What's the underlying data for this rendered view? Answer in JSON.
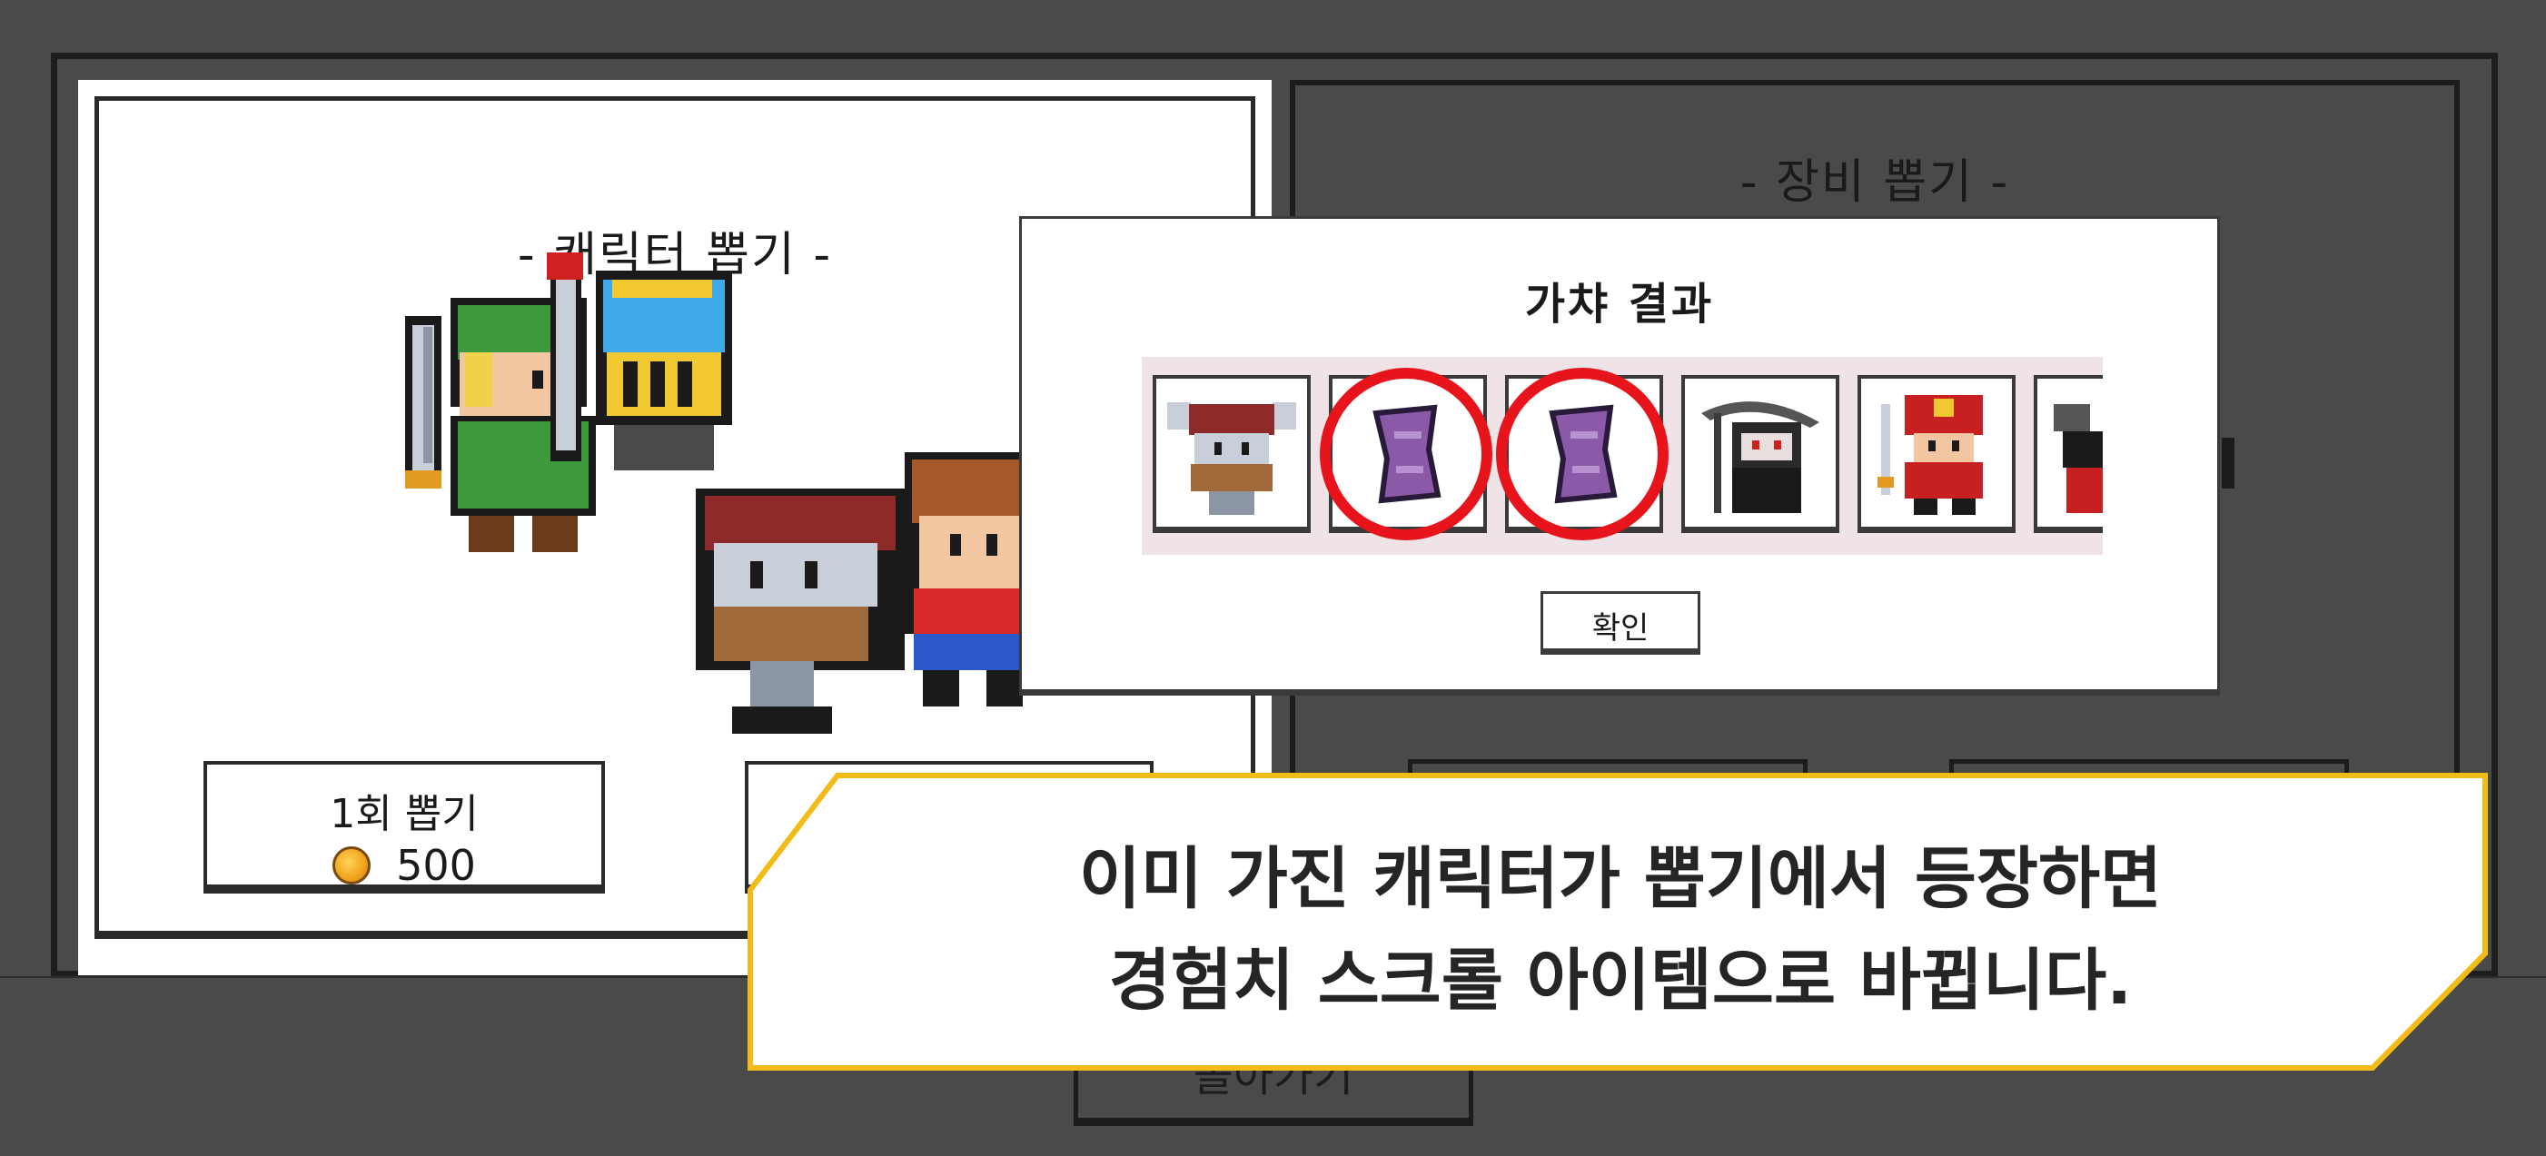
{
  "character_panel": {
    "title": "- 캐릭터 뽑기 -",
    "single_draw": {
      "label": "1회 뽑기",
      "cost": "500",
      "currency_icon": "gold-coin-icon"
    }
  },
  "equipment_panel": {
    "title": "- 장비 뽑기 -"
  },
  "back_button": {
    "label": "돌아가기"
  },
  "gacha_result": {
    "title": "가챠 결과",
    "items": [
      {
        "name": "viking-warrior-sprite",
        "highlighted": false
      },
      {
        "name": "exp-scroll-sprite",
        "highlighted": true
      },
      {
        "name": "exp-scroll-sprite",
        "highlighted": true
      },
      {
        "name": "reaper-sprite",
        "highlighted": false
      },
      {
        "name": "samurai-sprite",
        "highlighted": false
      },
      {
        "name": "partial-character-sprite",
        "highlighted": false
      }
    ],
    "confirm_label": "확인"
  },
  "callout": {
    "line1": "이미 가진 캐릭터가 뽑기에서 등장하면",
    "line2": "경험치 스크롤 아이템으로 바뀝니다."
  },
  "colors": {
    "background": "#4a4a4a",
    "highlight_ring": "#e8141b",
    "callout_border": "#f2bb16",
    "scroll_purple": "#8a5aa8"
  }
}
